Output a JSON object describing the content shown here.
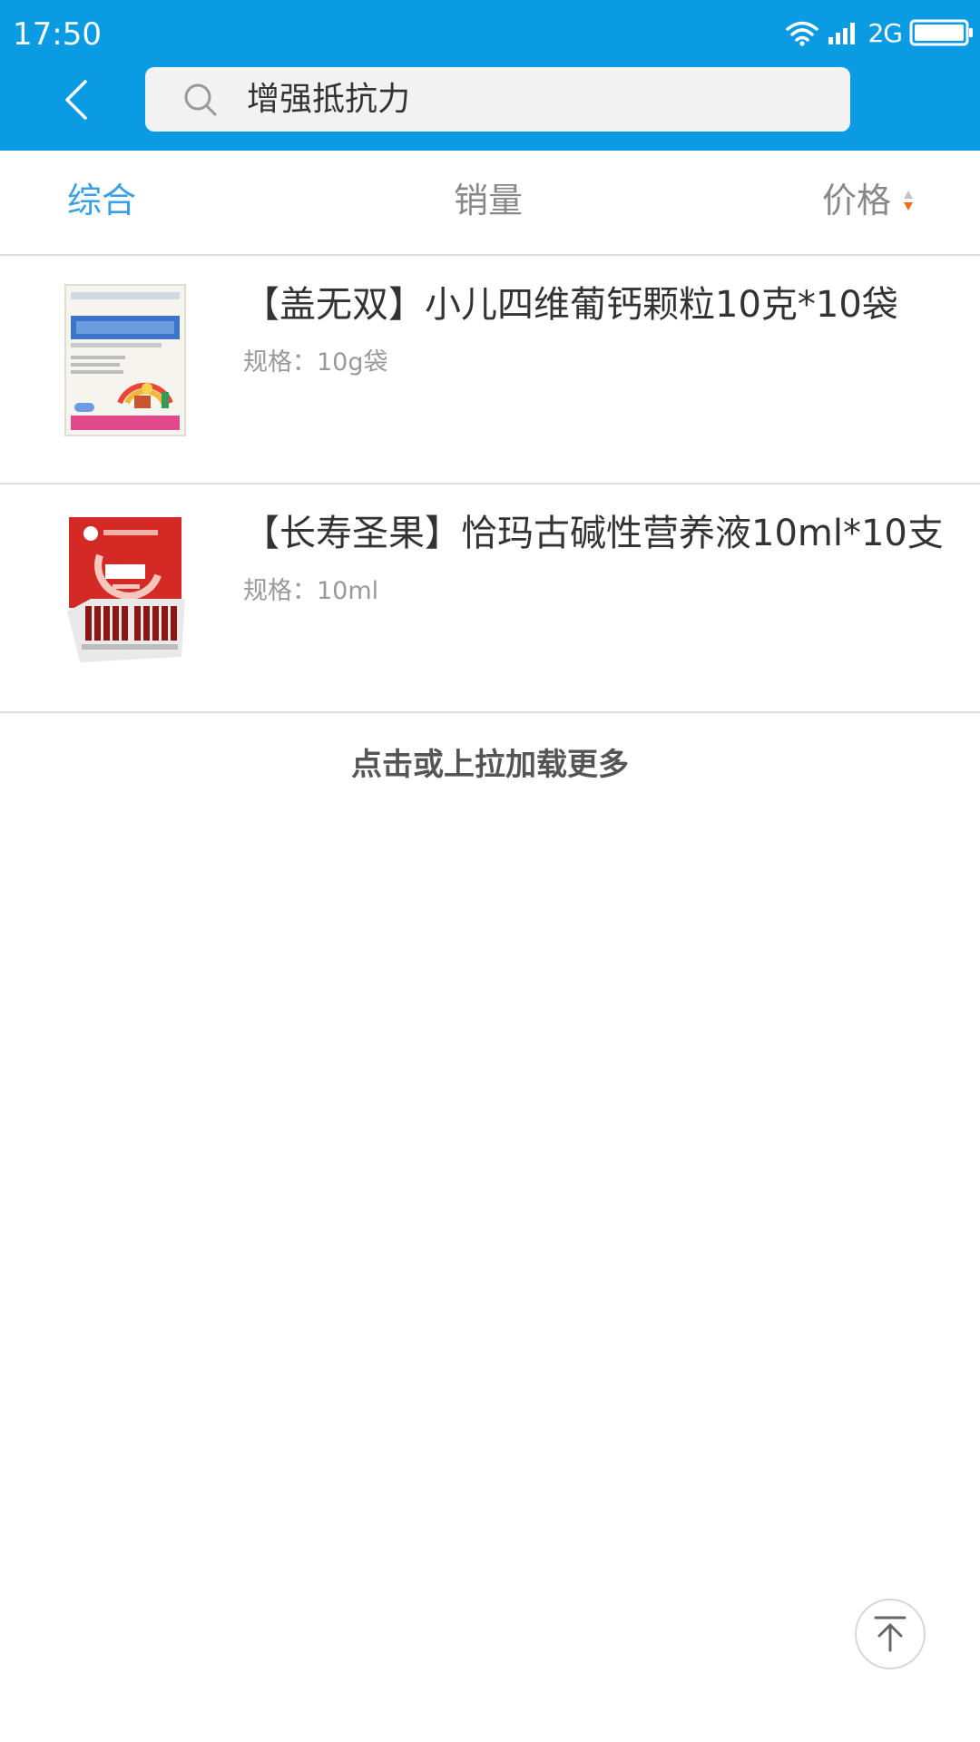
{
  "status_bar": {
    "time": "17:50",
    "network": "2G"
  },
  "colors": {
    "header_bg": "#0b9be2",
    "active_tab": "#3a9fe3",
    "sort_accent": "#f26b21"
  },
  "header": {
    "back_icon": "chevron-left-icon",
    "search_icon": "search-icon",
    "search_query": "增强抵抗力"
  },
  "tabs": [
    {
      "label": "综合",
      "active": true
    },
    {
      "label": "销量",
      "active": false
    },
    {
      "label": "价格",
      "active": false
    }
  ],
  "products": [
    {
      "title": "【盖无双】小儿四维葡钙颗粒10克*10袋",
      "spec": "规格：10g袋"
    },
    {
      "title": "【长寿圣果】恰玛古碱性营养液10ml*10支",
      "spec": "规格：10ml"
    }
  ],
  "load_more": "点击或上拉加载更多",
  "back_to_top_icon": "arrow-up-icon"
}
